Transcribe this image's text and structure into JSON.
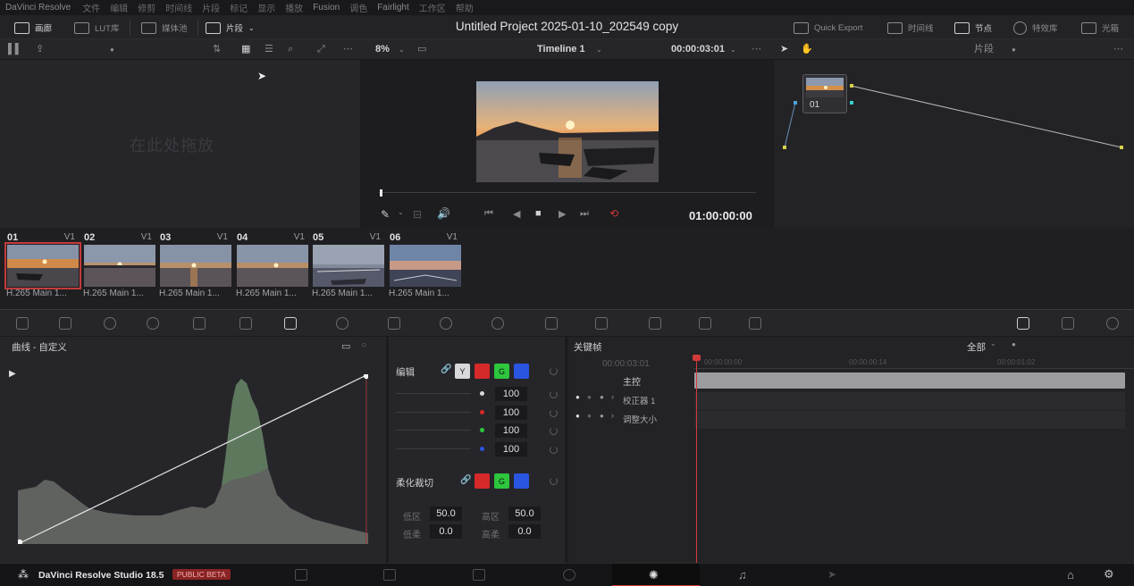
{
  "menubar": {
    "app_name": "DaVinci Resolve",
    "items": [
      "文件",
      "编辑",
      "修剪",
      "时间线",
      "片段",
      "标记",
      "显示",
      "播放",
      "Fusion",
      "调色",
      "Fairlight",
      "工作区",
      "帮助"
    ]
  },
  "titlebar": {
    "project_title": "Untitled Project 2025-01-10_202549 copy",
    "gallery_label": "画廊",
    "lut_label": "LUT库",
    "media_pool_label": "媒体池",
    "clips_label": "片段",
    "quick_export_label": "Quick Export",
    "timeline_label": "时间线",
    "nodes_label": "节点",
    "effects_label": "特效库",
    "lightbox_label": "光箱"
  },
  "toolbar": {
    "zoom": "8%",
    "timeline_name": "Timeline 1",
    "timecode": "00:00:03:01",
    "clip_mode": "片段"
  },
  "gallery": {
    "empty_text": "在此处拖放"
  },
  "viewer": {
    "timecode": "01:00:00:00"
  },
  "nodes": {
    "node_label": "01"
  },
  "clips": [
    {
      "num": "01",
      "track": "V1",
      "codec": "H.265 Main 1..."
    },
    {
      "num": "02",
      "track": "V1",
      "codec": "H.265 Main 1..."
    },
    {
      "num": "03",
      "track": "V1",
      "codec": "H.265 Main 1..."
    },
    {
      "num": "04",
      "track": "V1",
      "codec": "H.265 Main 1..."
    },
    {
      "num": "05",
      "track": "V1",
      "codec": "H.265 Main 1..."
    },
    {
      "num": "06",
      "track": "V1",
      "codec": "H.265 Main 1..."
    }
  ],
  "curves": {
    "title": "曲线 - 自定义"
  },
  "edit": {
    "title": "编辑",
    "y_label": "Y",
    "g_label": "G",
    "values": [
      "100",
      "100",
      "100",
      "100"
    ],
    "soft_clip_label": "柔化裁切",
    "low_label": "低区",
    "high_label": "高区",
    "low_soft_label": "低柔",
    "high_soft_label": "高柔",
    "low_value": "50.0",
    "high_value": "50.0",
    "low_soft_value": "0.0",
    "high_soft_value": "0.0"
  },
  "keyframes": {
    "title": "关键帧",
    "filter": "全部",
    "timecode": "00:00:03:01",
    "ruler": [
      "00:00:00:00",
      "00:00:00:14",
      "00:00:01:02"
    ],
    "master_label": "主控",
    "tracks": [
      "校正器 1",
      "调整大小"
    ]
  },
  "bottombar": {
    "app_label": "DaVinci Resolve Studio 18.5",
    "badge": "PUBLIC BETA"
  }
}
